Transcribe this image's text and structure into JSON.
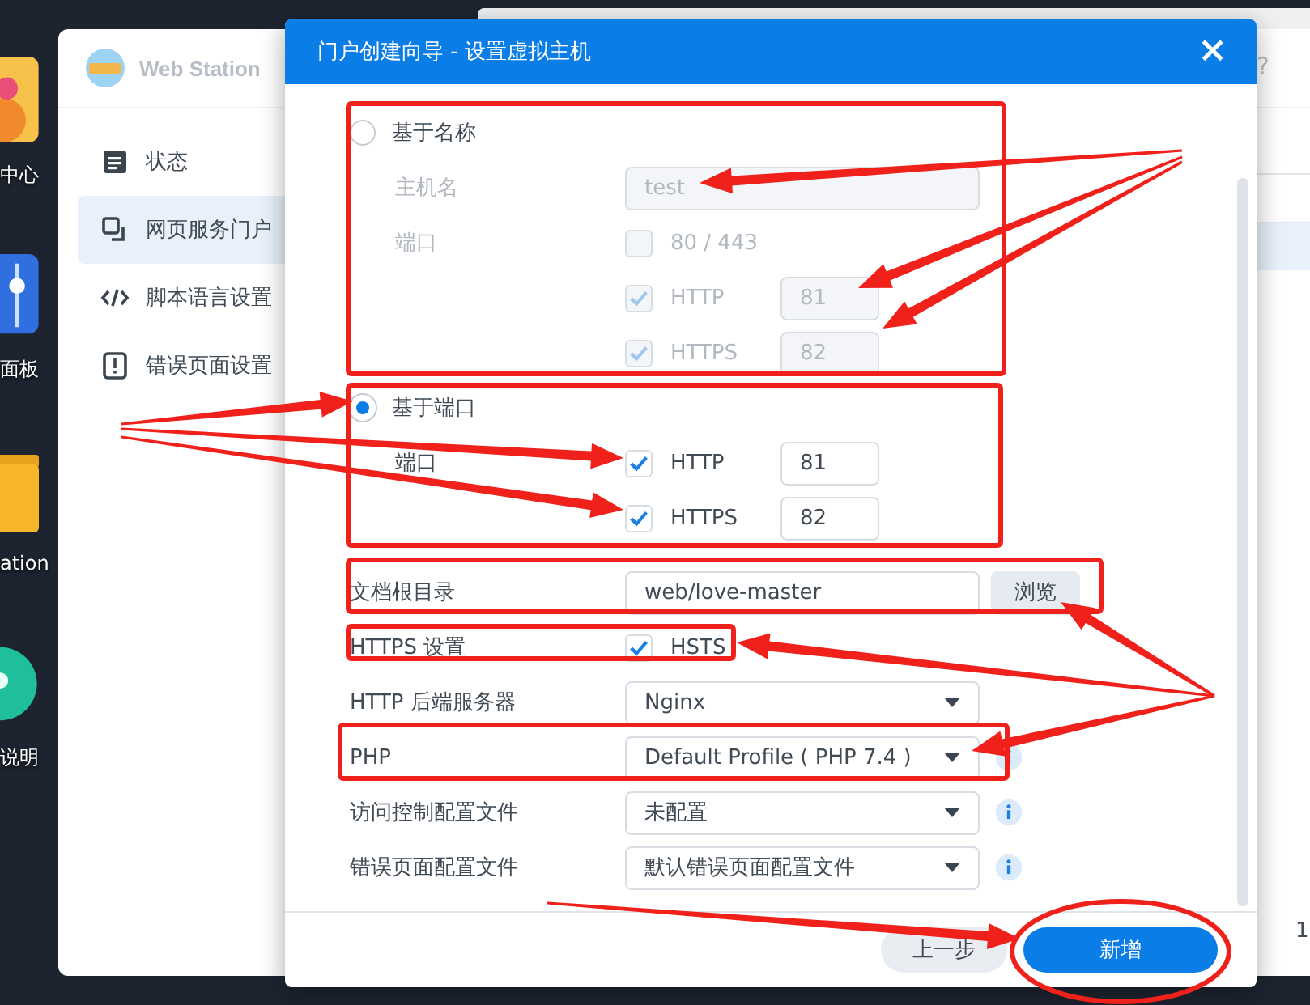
{
  "desktop_icons": [
    {
      "label": "中心"
    },
    {
      "label": "面板"
    },
    {
      "label": "ation"
    },
    {
      "label": "说明"
    }
  ],
  "background_window": {
    "title": "Web Station",
    "help": "?",
    "sidebar": [
      {
        "label": "状态",
        "selected": false
      },
      {
        "label": "网页服务门户",
        "selected": true
      },
      {
        "label": "脚本语言设置",
        "selected": false
      },
      {
        "label": "错误页面设置",
        "selected": false
      }
    ],
    "corner_text": "1"
  },
  "dialog": {
    "title": "门户创建向导 - 设置虚拟主机",
    "close": "×",
    "modes": [
      {
        "label": "基于名称",
        "selected": false,
        "hostname_label": "主机名",
        "hostname": "test",
        "port_label": "端口",
        "ports": [
          {
            "label": "80 / 443",
            "checked": false
          },
          {
            "label": "HTTP",
            "checked": true,
            "value": "81"
          },
          {
            "label": "HTTPS",
            "checked": true,
            "value": "82"
          }
        ]
      },
      {
        "label": "基于端口",
        "selected": true,
        "port_label": "端口",
        "ports": [
          {
            "label": "HTTP",
            "checked": true,
            "value": "81"
          },
          {
            "label": "HTTPS",
            "checked": true,
            "value": "82"
          }
        ]
      }
    ],
    "fields": [
      {
        "kind": "path",
        "label": "文档根目录",
        "value": "web/love-master",
        "button": "浏览"
      },
      {
        "kind": "checkbox",
        "label": "HTTPS 设置",
        "option": "HSTS",
        "checked": true
      },
      {
        "kind": "select",
        "label": "HTTP 后端服务器",
        "value": "Nginx",
        "info": false
      },
      {
        "kind": "select",
        "label": "PHP",
        "value": "Default Profile ( PHP 7.4 )",
        "info": true
      },
      {
        "kind": "select",
        "label": "访问控制配置文件",
        "value": "未配置",
        "info": true
      },
      {
        "kind": "select",
        "label": "错误页面配置文件",
        "value": "默认错误页面配置文件",
        "info": true
      }
    ],
    "buttons": [
      {
        "label": "上一步",
        "kind": "secondary"
      },
      {
        "label": "新增",
        "kind": "primary"
      }
    ]
  }
}
